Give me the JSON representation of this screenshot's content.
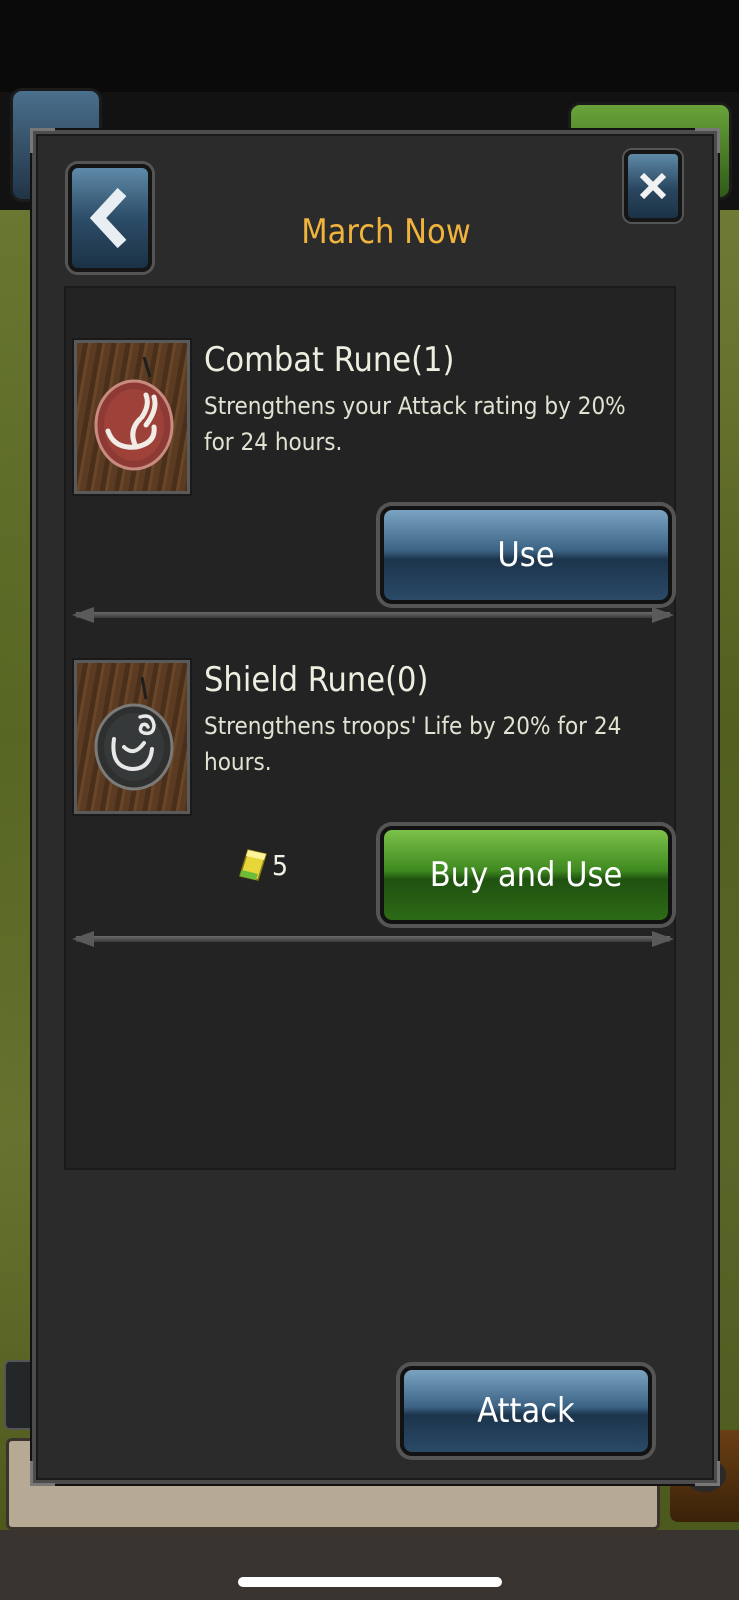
{
  "dialog": {
    "title": "March Now",
    "back_icon": "chevron-left-icon",
    "close_icon": "close-icon"
  },
  "items": [
    {
      "name": "Combat Rune(1)",
      "description": "Strengthens your Attack rating by 20% for 24 hours.",
      "icon": "combat-rune-icon",
      "button_label": "Use",
      "button_color": "#3c6384"
    },
    {
      "name": "Shield Rune(0)",
      "description": "Strengthens troops' Life by 20% for 24 hours.",
      "icon": "shield-rune-icon",
      "price": "5",
      "price_icon": "gold-bar-icon",
      "button_label": "Buy and Use",
      "button_color": "#3f8a20"
    }
  ],
  "footer": {
    "attack_label": "Attack"
  },
  "colors": {
    "title": "#f0b43c",
    "panel": "#2b2b2b"
  }
}
